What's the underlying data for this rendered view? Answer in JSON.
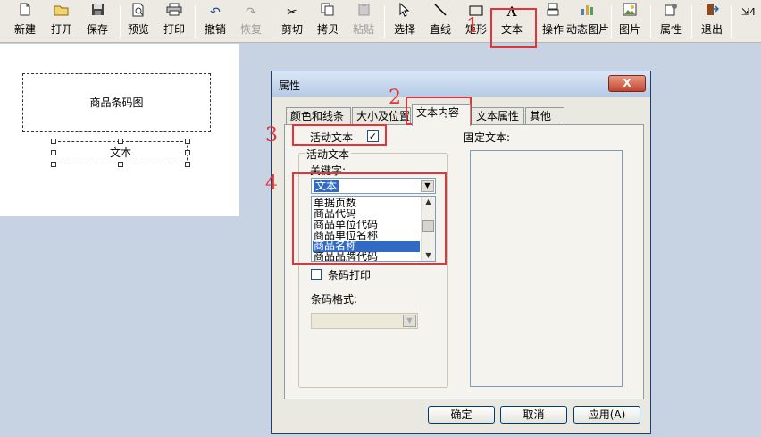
{
  "toolbar": {
    "buttons": [
      {
        "label": "新建",
        "icon": "new-file-icon"
      },
      {
        "label": "打开",
        "icon": "open-folder-icon"
      },
      {
        "label": "保存",
        "icon": "save-disk-icon"
      },
      {
        "label": "预览",
        "icon": "preview-icon"
      },
      {
        "label": "打印",
        "icon": "printer-icon"
      },
      {
        "label": "撤销",
        "icon": "undo-icon"
      },
      {
        "label": "恢复",
        "icon": "redo-icon",
        "disabled": true
      },
      {
        "label": "剪切",
        "icon": "scissors-icon"
      },
      {
        "label": "拷贝",
        "icon": "copy-icon"
      },
      {
        "label": "粘贴",
        "icon": "paste-icon",
        "disabled": true
      },
      {
        "label": "选择",
        "icon": "pointer-icon"
      },
      {
        "label": "直线",
        "icon": "line-icon"
      },
      {
        "label": "矩形",
        "icon": "rectangle-icon"
      },
      {
        "label": "文本",
        "icon": "text-icon"
      },
      {
        "label": "操作",
        "icon": "operation-icon"
      },
      {
        "label": "动态图片",
        "icon": "dynamic-image-icon"
      },
      {
        "label": "图片",
        "icon": "image-icon"
      },
      {
        "label": "属性",
        "icon": "properties-icon"
      },
      {
        "label": "退出",
        "icon": "exit-icon"
      }
    ],
    "overflow_label": "4",
    "text_icon_glyph": "A"
  },
  "canvas": {
    "barcode_label": "商品条码图",
    "text_label": "文本"
  },
  "dialog": {
    "title": "属性",
    "close_glyph": "X",
    "tabs": [
      "颜色和线条",
      "大小及位置",
      "文本内容",
      "文本属性",
      "其他"
    ],
    "active_tab": 2,
    "active_text_label": "活动文本",
    "active_text_checked_glyph": "✓",
    "group_label": "活动文本",
    "keyword_label": "关键字:",
    "keyword_value": "文本",
    "keyword_options": [
      "单据页数",
      "商品代码",
      "商品单位代码",
      "商品单位名称",
      "商品名称",
      "商品品牌代码"
    ],
    "selected_option": 4,
    "barcode_print_label": "条码打印",
    "barcode_format_label": "条码格式:",
    "fixed_text_label": "固定文本:",
    "buttons": {
      "ok": "确定",
      "cancel": "取消",
      "apply": "应用(A)"
    }
  },
  "annotations": {
    "n1": "1",
    "n2": "2",
    "n3": "3",
    "n4": "4",
    "color": "#e2343a"
  }
}
